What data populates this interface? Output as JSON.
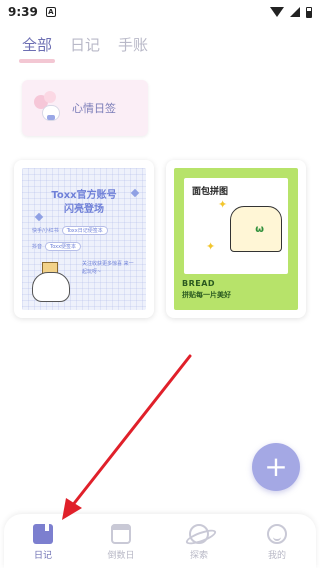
{
  "status_bar": {
    "time": "9:39",
    "notification_badge": "A"
  },
  "tabs": [
    {
      "label": "全部",
      "active": true
    },
    {
      "label": "日记",
      "active": false
    },
    {
      "label": "手账",
      "active": false
    }
  ],
  "mood_card": {
    "label": "心情日签"
  },
  "notebooks": [
    {
      "title_line1": "Toxx官方账号",
      "title_line2": "闪亮登场",
      "row1_prefix": "快手/小红书",
      "row1_pill": "Toxx日记便签本",
      "row2_prefix": "抖音",
      "row2_pill": "Toxx便签本",
      "note": "关注收获更多惊喜 来一起玩呀~"
    },
    {
      "title": "面包拼图",
      "face": "ω",
      "brand": "BREAD",
      "slogan": "拼贴每一片美好"
    }
  ],
  "fab": {
    "icon": "plus-icon",
    "symbol": "+"
  },
  "bottom_nav": [
    {
      "label": "日记",
      "icon": "diary-icon",
      "active": true
    },
    {
      "label": "倒数日",
      "icon": "calendar-icon",
      "active": false
    },
    {
      "label": "探索",
      "icon": "planet-icon",
      "active": false
    },
    {
      "label": "我的",
      "icon": "smile-icon",
      "active": false
    }
  ],
  "colors": {
    "accent": "#6d6fb3",
    "fab": "#a4a8e4",
    "arrow": "#e0202a",
    "tab_underline": "#f3c7d3"
  }
}
